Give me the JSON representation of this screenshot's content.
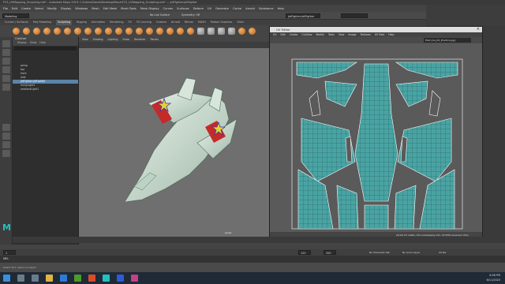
{
  "window_title": "F23_UVMapping_Sculpting.mb* - Autodesk Maya 2019: C:\\Users\\David\\Desktop\\Maya\\F23_UVMapping_Sculpting.mb* --- jetFighter:jetFighter",
  "menus": [
    "File",
    "Edit",
    "Create",
    "Select",
    "Modify",
    "Display",
    "Windows",
    "Mesh",
    "Edit Mesh",
    "Mesh Tools",
    "Mesh Display",
    "Curves",
    "Surfaces",
    "Deform",
    "UV",
    "Generate",
    "Cache",
    "Arnold",
    "Substance",
    "Help"
  ],
  "status": {
    "mode": "Modeling",
    "no_live_surface": "No Live Surface",
    "symmetry": "Symmetry: Off",
    "object_name": "jetFighter:jetFighter",
    "workspace": "Workspace:",
    "workspace_value": "Maya Classic"
  },
  "shelf_tabs": [
    "Curves / Surfaces",
    "Poly Modeling",
    "Sculpting",
    "Rigging",
    "Animation",
    "Rendering",
    "FX",
    "FX Caching",
    "Custom",
    "Arnold",
    "Bifrost",
    "MASH",
    "Motion Graphics",
    "XGen"
  ],
  "active_shelf": "Sculpting",
  "outliner": {
    "title": "Outliner",
    "menu": [
      "Display",
      "Show",
      "Help"
    ],
    "items": [
      "persp",
      "top",
      "front",
      "side",
      "jetFighter:jetFighter",
      "shinyLight1",
      "ambientLight1"
    ],
    "selected_index": 4
  },
  "viewport": {
    "menu": [
      "View",
      "Shading",
      "Lighting",
      "Show",
      "Renderer",
      "Panels"
    ],
    "camera_label": "persp"
  },
  "uv_editor": {
    "title": "UV Editor",
    "menu": [
      "UV",
      "Edit",
      "Create",
      "Cut/Sew",
      "Modify",
      "Tools",
      "View",
      "Image",
      "Textures",
      "UV Sets",
      "Help"
    ],
    "texture": "file1 (ice_02_Practice.jpg)",
    "status": "(9/10) UV shells, 0/0 overlapping UVs, 0/7438 (reversed UVs)"
  },
  "timeline": {
    "start": "1",
    "end": "120",
    "range_end": "200",
    "character_set": "No Character Set",
    "anim_layer": "No Anim Layer",
    "fps": "24 fps"
  },
  "mel_label": "MEL",
  "help_line": "Select Tool: select an object",
  "taskbar": {
    "time": "8:58 PM",
    "date": "6/11/2020"
  },
  "colors": {
    "maya_bg": "#444444",
    "viewport_bg": "#6f6f6f",
    "uv_bg": "#5a5a5a",
    "uv_line": "#ffffff",
    "uv_fill": "#4aa3a3",
    "selection": "#5b84a8",
    "taskbar": "#1f2a36"
  }
}
